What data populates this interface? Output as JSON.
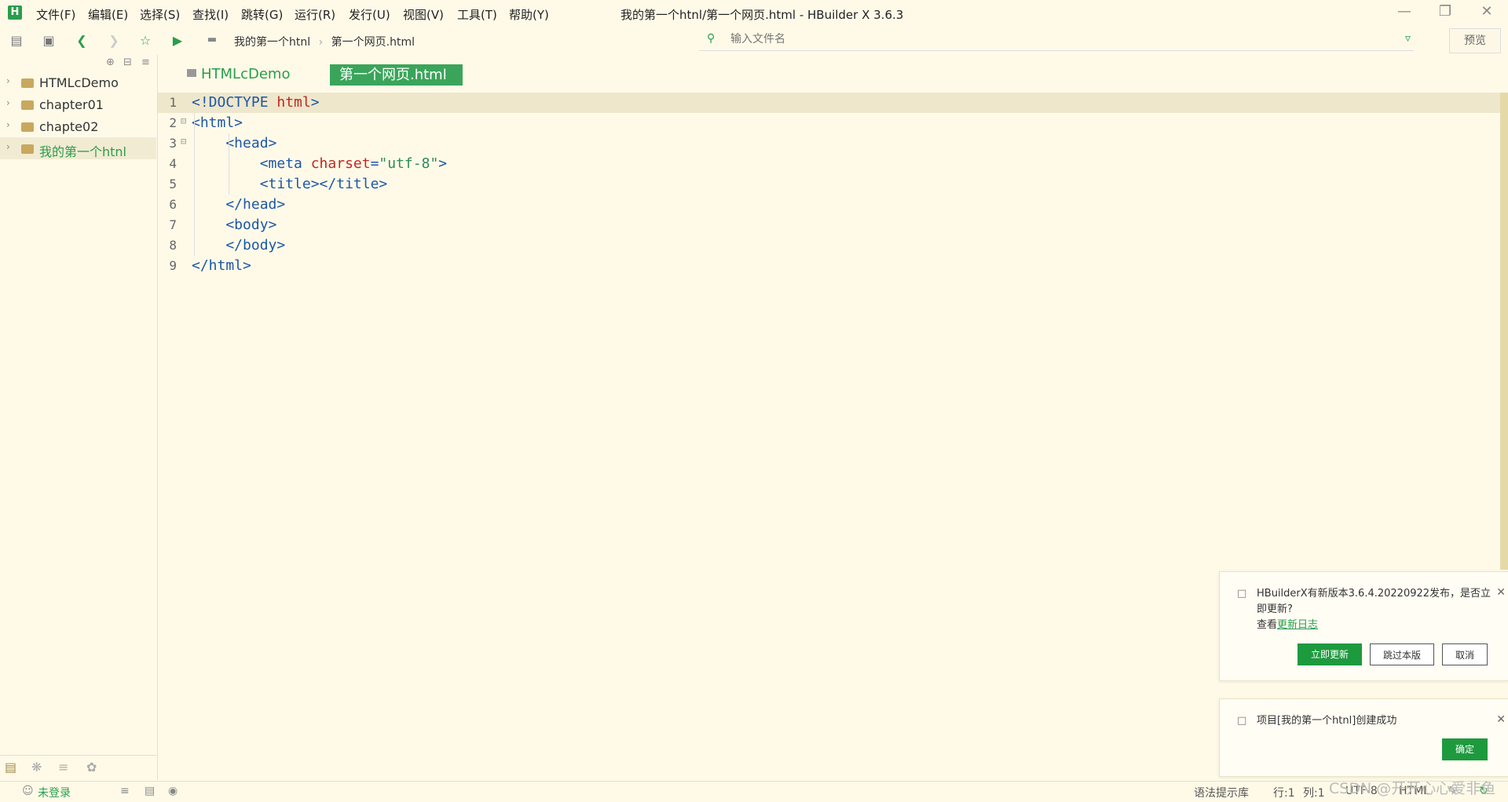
{
  "menubar": {
    "logo": "H",
    "items": [
      "文件(F)",
      "编辑(E)",
      "选择(S)",
      "查找(I)",
      "跳转(G)",
      "运行(R)",
      "发行(U)",
      "视图(V)",
      "工具(T)",
      "帮助(Y)"
    ],
    "title": "我的第一个htnl/第一个网页.html - HBuilder X 3.6.3",
    "window_buttons": [
      "minimize-icon",
      "restore-icon",
      "close-icon"
    ]
  },
  "toolbar": {
    "breadcrumb": [
      "我的第一个htnl",
      "第一个网页.html"
    ],
    "search_placeholder": "输入文件名",
    "preview_label": "预览"
  },
  "sidebar": {
    "projects": [
      "HTMLcDemo",
      "chapter01",
      "chapte02",
      "我的第一个htnl"
    ],
    "active_index": 3
  },
  "tabs": {
    "project_label": "HTMLcDemo",
    "file_label": "第一个网页.html"
  },
  "editor": {
    "line_numbers": [
      "1",
      "2",
      "3",
      "4",
      "5",
      "6",
      "7",
      "8",
      "9"
    ],
    "lines": [
      [
        [
          "tag",
          "<!DOCTYPE "
        ],
        [
          "att",
          "html"
        ],
        [
          "tag",
          ">"
        ]
      ],
      [
        [
          "tag",
          "<html>"
        ]
      ],
      [
        [
          "tag",
          "    <head>"
        ]
      ],
      [
        [
          "tag",
          "        <meta "
        ],
        [
          "att",
          "charset"
        ],
        [
          "tag",
          "="
        ],
        [
          "str",
          "\"utf-8\""
        ],
        [
          "tag",
          ">"
        ]
      ],
      [
        [
          "tag",
          "        <title></title>"
        ]
      ],
      [
        [
          "tag",
          "    </head>"
        ]
      ],
      [
        [
          "tag",
          "    <body>"
        ]
      ],
      [
        [
          "tag",
          "    </body>"
        ]
      ],
      [
        [
          "tag",
          "</html>"
        ]
      ]
    ],
    "current_line": 1
  },
  "notifications": {
    "update": {
      "text": "HBuilderX有新版本3.6.4.20220922发布，是否立即更新?",
      "log_prefix": "查看",
      "log_link": "更新日志",
      "buttons": [
        "立即更新",
        "跳过本版",
        "取消"
      ]
    },
    "created": {
      "text": "项目[我的第一个htnl]创建成功",
      "button": "确定"
    }
  },
  "statusbar": {
    "login": "未登录",
    "syntax": "语法提示库",
    "row": "行:1",
    "col": "列:1",
    "encoding": "UTF-8",
    "language": "HTML"
  },
  "watermark": "CSDN @开开心心爱非鱼",
  "colors": {
    "accent": "#2a9d4b",
    "background": "#fffae8"
  }
}
